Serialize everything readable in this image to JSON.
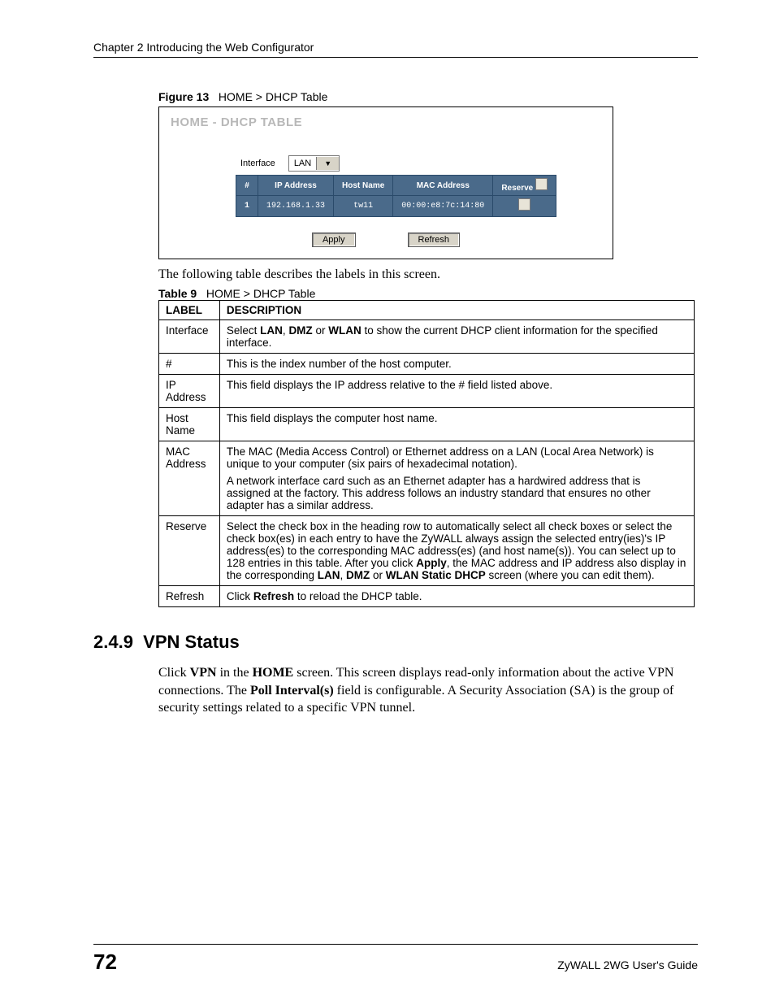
{
  "header": {
    "chapter": "Chapter 2 Introducing the Web Configurator"
  },
  "figure": {
    "label": "Figure 13",
    "title": "HOME > DHCP Table"
  },
  "screenshot": {
    "title": "HOME - DHCP TABLE",
    "interface_label": "Interface",
    "interface_value": "LAN",
    "columns": {
      "num": "#",
      "ip": "IP Address",
      "host": "Host Name",
      "mac": "MAC Address",
      "reserve": "Reserve"
    },
    "rows": [
      {
        "num": "1",
        "ip": "192.168.1.33",
        "host": "tw11",
        "mac": "00:00:e8:7c:14:80"
      }
    ],
    "buttons": {
      "apply": "Apply",
      "refresh": "Refresh"
    }
  },
  "intro_text": "The following table describes the labels in this screen.",
  "table_caption": {
    "label": "Table 9",
    "title": "HOME > DHCP Table"
  },
  "desc": {
    "head_label": "LABEL",
    "head_desc": "DESCRIPTION",
    "rows": {
      "r0": {
        "label": "Interface",
        "p1a": "Select ",
        "b1": "LAN",
        "p1b": ", ",
        "b2": "DMZ",
        "p1c": " or ",
        "b3": "WLAN",
        "p1d": " to show the current DHCP client information for the specified interface."
      },
      "r1": {
        "label": "#",
        "desc": "This is the index number of the host computer."
      },
      "r2": {
        "label": "IP Address",
        "desc": "This field displays the IP address relative to the # field listed above."
      },
      "r3": {
        "label": "Host Name",
        "desc": "This field displays the computer host name."
      },
      "r4": {
        "label": "MAC Address",
        "p1": "The MAC (Media Access Control) or Ethernet address on a LAN (Local Area Network) is unique to your computer (six pairs of hexadecimal notation).",
        "p2": "A network interface card such as an Ethernet adapter has a hardwired address that is assigned at the factory. This address follows an industry standard that ensures no other adapter has a similar address."
      },
      "r5": {
        "label": "Reserve",
        "a": "Select the check box in the heading row to automatically select all check boxes or select the check box(es) in each entry to have the ZyWALL always assign the selected entry(ies)'s IP address(es) to the corresponding MAC address(es) (and host name(s)). You can select up to 128 entries in this table. After you click ",
        "b1": "Apply",
        "b": ", the MAC address and IP address also display in the corresponding ",
        "b2": "LAN",
        "c": ", ",
        "b3": "DMZ",
        "d": " or ",
        "b4": "WLAN Static DHCP",
        "e": " screen (where you can edit them)."
      },
      "r6": {
        "label": "Refresh",
        "a": "Click ",
        "b1": "Refresh",
        "b": " to reload the DHCP table."
      }
    }
  },
  "section": {
    "number": "2.4.9",
    "title": "VPN Status",
    "body_a": "Click ",
    "b1": "VPN",
    "body_b": " in the ",
    "b2": "HOME",
    "body_c": " screen. This screen displays read-only information about the active VPN connections. The ",
    "b3": "Poll Interval(s)",
    "body_d": " field is configurable. A Security Association (SA) is the group of security settings related to a specific VPN tunnel."
  },
  "footer": {
    "page": "72",
    "guide": "ZyWALL 2WG User's Guide"
  }
}
